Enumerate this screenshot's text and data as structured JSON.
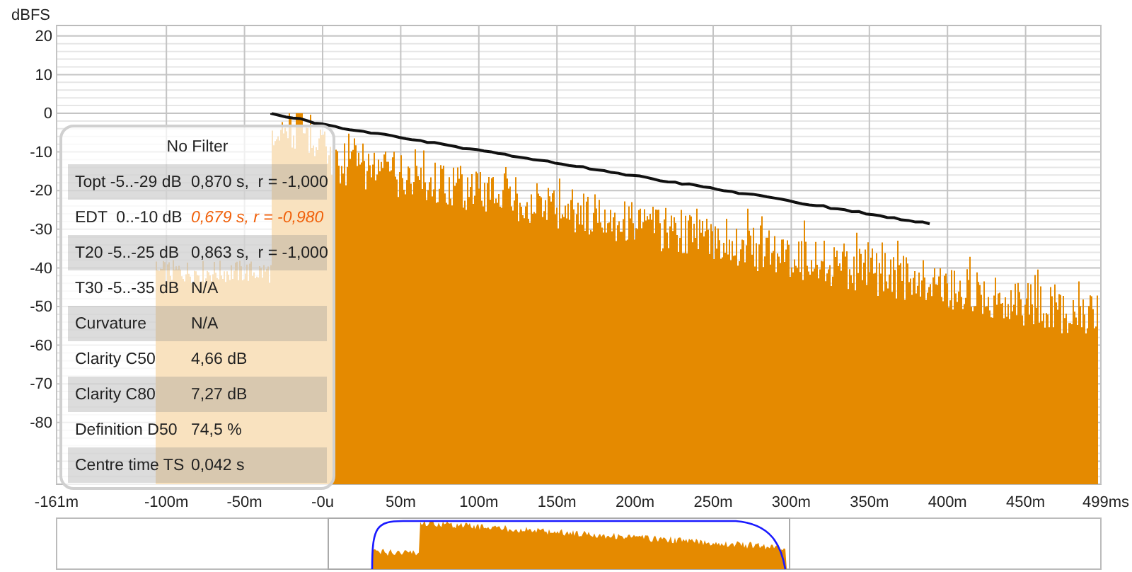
{
  "chart": {
    "ylabel": "dBFS",
    "yticks": [
      "20",
      "10",
      "0",
      "-10",
      "-20",
      "-30",
      "-40",
      "-50",
      "-60",
      "-70",
      "-80"
    ],
    "xticks": [
      "-161m",
      "-100m",
      "-50m",
      "-0u",
      "50m",
      "100m",
      "150m",
      "200m",
      "250m",
      "300m",
      "350m",
      "400m",
      "450m",
      "499ms"
    ]
  },
  "panel": {
    "title": "No Filter",
    "rows": [
      {
        "label": "Topt -5..-29 dB",
        "value": "0,870 s,  r = -1,000",
        "kind": "normal"
      },
      {
        "label": "EDT  0..-10 dB",
        "value": "0,679 s, r = -0,980",
        "kind": "warning"
      },
      {
        "label": "T20 -5..-25 dB",
        "value": "0,863 s,  r = -1,000",
        "kind": "normal"
      },
      {
        "label": "T30 -5..-35 dB",
        "value": "N/A",
        "kind": "normal"
      },
      {
        "label": "Curvature",
        "value": "N/A",
        "kind": "normal"
      },
      {
        "label": "Clarity C50",
        "value": "4,66 dB",
        "kind": "normal"
      },
      {
        "label": "Clarity C80",
        "value": "7,27 dB",
        "kind": "normal"
      },
      {
        "label": "Definition D50",
        "value": "74,5 %",
        "kind": "normal"
      },
      {
        "label": "Centre time TS",
        "value": "0,042 s",
        "kind": "normal"
      }
    ]
  }
}
